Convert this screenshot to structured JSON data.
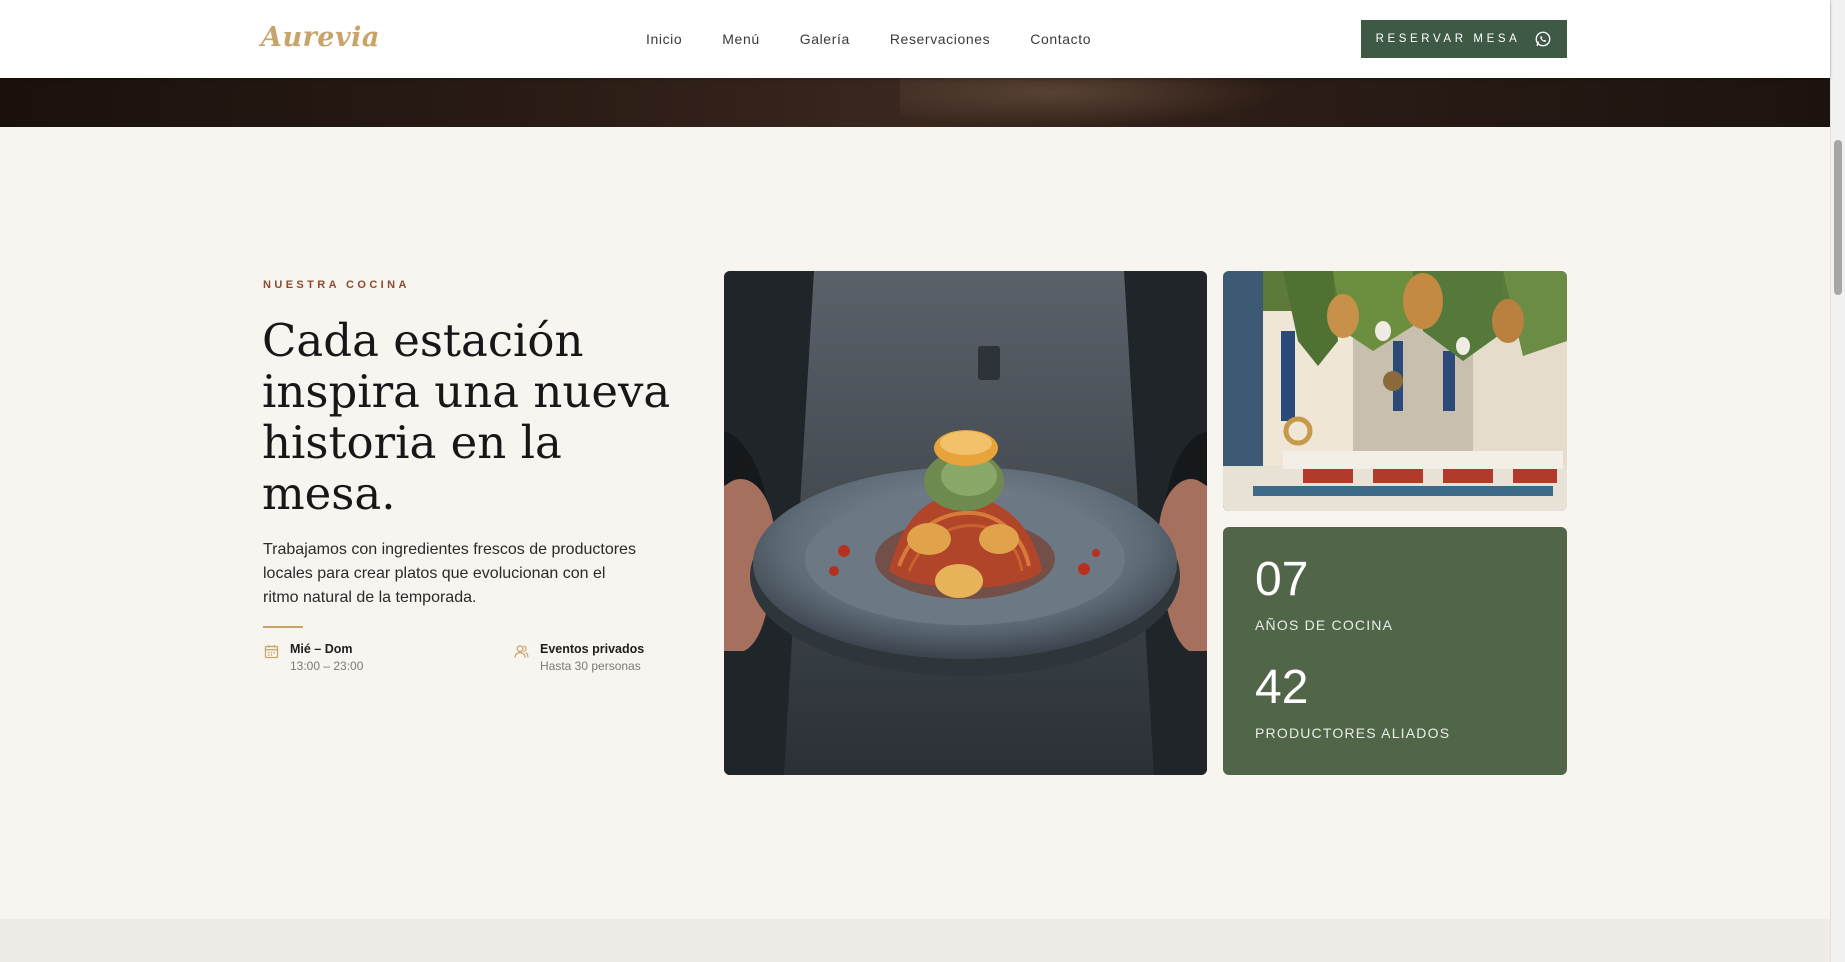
{
  "brand": {
    "logo_text": "Aurevia",
    "logo_color": "#c8a36a"
  },
  "nav": {
    "items": [
      {
        "label": "Inicio"
      },
      {
        "label": "Menú"
      },
      {
        "label": "Galería"
      },
      {
        "label": "Reservaciones"
      },
      {
        "label": "Contacto"
      }
    ]
  },
  "cta": {
    "label": "RESERVAR MESA",
    "icon": "whatsapp-icon",
    "bg_color": "#3f5a44"
  },
  "section": {
    "eyebrow": "NUESTRA COCINA",
    "headline": "Cada estación inspira una nueva historia en la mesa.",
    "body": "Trabajamos con ingredientes frescos de productores locales para crear platos que evolucionan con el ritmo natural de la temporada.",
    "info": [
      {
        "icon": "calendar-icon",
        "title": "Mié – Dom",
        "subtitle": "13:00 – 23:00"
      },
      {
        "icon": "users-icon",
        "title": "Eventos privados",
        "subtitle": "Hasta 30 personas"
      }
    ]
  },
  "stats": {
    "card_color": "#516649",
    "items": [
      {
        "number": "07",
        "label": "AÑOS DE COCINA"
      },
      {
        "number": "42",
        "label": "PRODUCTORES ALIADOS"
      }
    ]
  },
  "colors": {
    "background": "#f8f5f0",
    "accent": "#c8a36a",
    "eyebrow": "#8a4a2e"
  }
}
